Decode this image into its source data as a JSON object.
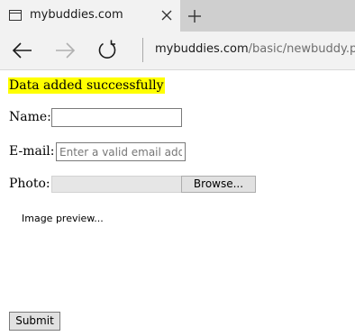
{
  "browser": {
    "tab": {
      "title": "mybuddies.com",
      "icon": "page-icon",
      "close_icon": "close-icon"
    },
    "new_tab_icon": "plus-icon",
    "nav": {
      "back_icon": "arrow-left-icon",
      "forward_icon": "arrow-right-icon",
      "refresh_icon": "refresh-icon"
    },
    "address": {
      "host": "mybuddies.com",
      "path": "/basic/newbuddy.php"
    }
  },
  "page": {
    "success_message": "Data added successfully",
    "success_highlight_color": "#ffff00",
    "form": {
      "name_label": "Name:",
      "name_value": "",
      "email_label": "E-mail:",
      "email_placeholder": "Enter a valid email address",
      "email_value": "",
      "photo_label": "Photo:",
      "browse_label": "Browse...",
      "preview_text": "Image preview...",
      "submit_label": "Submit"
    }
  }
}
